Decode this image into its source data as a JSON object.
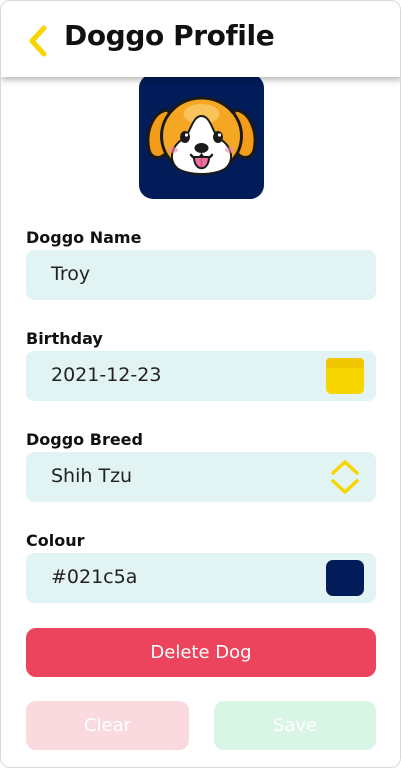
{
  "header": {
    "title": "Doggo Profile",
    "back_icon": "chevron-left-icon"
  },
  "avatar": {
    "icon": "dog-face-icon",
    "background_color": "#021c5a"
  },
  "form": {
    "name": {
      "label": "Doggo Name",
      "value": "Troy"
    },
    "birthday": {
      "label": "Birthday",
      "value": "2021-12-23",
      "icon": "calendar-icon"
    },
    "breed": {
      "label": "Doggo Breed",
      "value": "Shih Tzu",
      "icon": "up-down-chevron-icon"
    },
    "colour": {
      "label": "Colour",
      "value": "#021c5a",
      "swatch_color": "#021c5a"
    }
  },
  "actions": {
    "delete_label": "Delete Dog",
    "clear_label": "Clear",
    "save_label": "Save"
  },
  "colors": {
    "accent_yellow": "#f7d500",
    "field_background": "#e1f4f3",
    "delete_red": "#ec445c",
    "clear_pink": "#fadadf",
    "save_green": "#d8f5e5"
  }
}
